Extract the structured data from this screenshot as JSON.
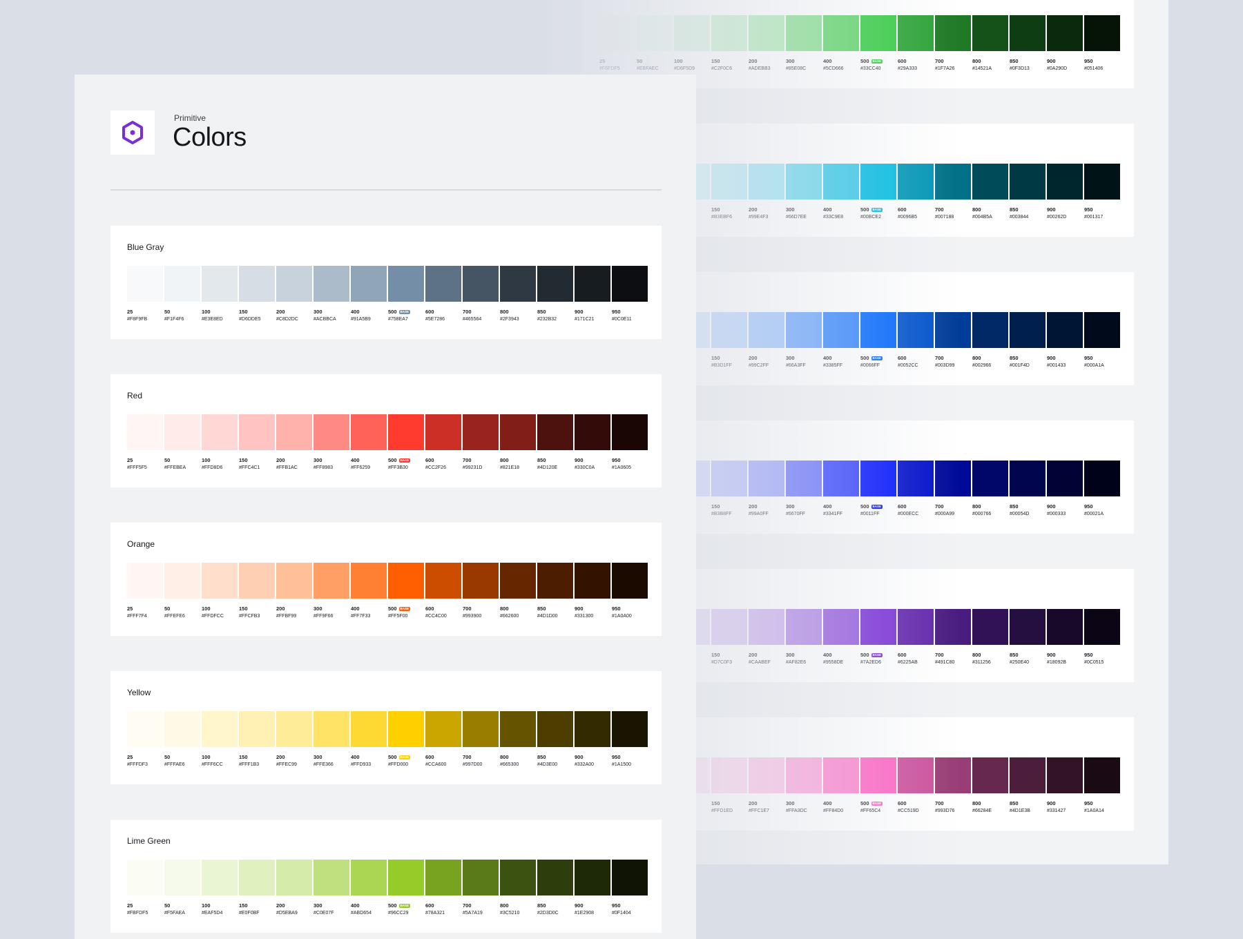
{
  "header": {
    "eyebrow": "Primitive",
    "title": "Colors",
    "logo_icon": "hexagon-logo-icon",
    "logo_color": "#7A2ED6"
  },
  "base_label": "BASE",
  "front_palettes": [
    {
      "name": "Blue Gray",
      "badge_color": "#758EA7",
      "swatches": [
        {
          "step": "25",
          "hex": "#F8F9FB",
          "color": "#F8F9FB"
        },
        {
          "step": "50",
          "hex": "#F1F4F6",
          "color": "#F1F4F6"
        },
        {
          "step": "100",
          "hex": "#E3E8ED",
          "color": "#E3E8ED"
        },
        {
          "step": "150",
          "hex": "#D6DDE5",
          "color": "#D6DDE5"
        },
        {
          "step": "200",
          "hex": "#C8D2DC",
          "color": "#C8D2DC"
        },
        {
          "step": "300",
          "hex": "#ACBBCA",
          "color": "#ACBBCA"
        },
        {
          "step": "400",
          "hex": "#91A5B9",
          "color": "#91A5B9"
        },
        {
          "step": "500",
          "hex": "#758EA7",
          "color": "#758EA7",
          "base": true
        },
        {
          "step": "600",
          "hex": "#5E7286",
          "color": "#5E7286"
        },
        {
          "step": "700",
          "hex": "#465564",
          "color": "#465564"
        },
        {
          "step": "800",
          "hex": "#2F3943",
          "color": "#2F3943"
        },
        {
          "step": "850",
          "hex": "#232B32",
          "color": "#232B32"
        },
        {
          "step": "900",
          "hex": "#171C21",
          "color": "#171C21"
        },
        {
          "step": "950",
          "hex": "#0C0E11",
          "color": "#0C0E11"
        }
      ]
    },
    {
      "name": "Red",
      "badge_color": "#FF3B30",
      "swatches": [
        {
          "step": "25",
          "hex": "#FFF5F5",
          "color": "#FFF5F5"
        },
        {
          "step": "50",
          "hex": "#FFEBEA",
          "color": "#FFEBEA"
        },
        {
          "step": "100",
          "hex": "#FFD8D6",
          "color": "#FFD8D6"
        },
        {
          "step": "150",
          "hex": "#FFC4C1",
          "color": "#FFC4C1"
        },
        {
          "step": "200",
          "hex": "#FFB1AC",
          "color": "#FFB1AC"
        },
        {
          "step": "300",
          "hex": "#FF8983",
          "color": "#FF8983"
        },
        {
          "step": "400",
          "hex": "#FF6259",
          "color": "#FF6259"
        },
        {
          "step": "500",
          "hex": "#FF3B30",
          "color": "#FF3B30",
          "base": true
        },
        {
          "step": "600",
          "hex": "#CC2F26",
          "color": "#CC2F26"
        },
        {
          "step": "700",
          "hex": "#99231D",
          "color": "#99231D"
        },
        {
          "step": "800",
          "hex": "#821E18",
          "color": "#821E18"
        },
        {
          "step": "850",
          "hex": "#4D120E",
          "color": "#4D120E"
        },
        {
          "step": "900",
          "hex": "#330C0A",
          "color": "#330C0A"
        },
        {
          "step": "950",
          "hex": "#1A0605",
          "color": "#1A0605"
        }
      ]
    },
    {
      "name": "Orange",
      "badge_color": "#FF5F00",
      "swatches": [
        {
          "step": "25",
          "hex": "#FFF7F4",
          "color": "#FFF7F4"
        },
        {
          "step": "50",
          "hex": "#FFEFE6",
          "color": "#FFEFE6"
        },
        {
          "step": "100",
          "hex": "#FFDFCC",
          "color": "#FFDFCC"
        },
        {
          "step": "150",
          "hex": "#FFCFB3",
          "color": "#FFCFB3"
        },
        {
          "step": "200",
          "hex": "#FFBF99",
          "color": "#FFBF99"
        },
        {
          "step": "300",
          "hex": "#FF9F66",
          "color": "#FF9F66"
        },
        {
          "step": "400",
          "hex": "#FF7F33",
          "color": "#FF7F33"
        },
        {
          "step": "500",
          "hex": "#FF5F00",
          "color": "#FF5F00",
          "base": true
        },
        {
          "step": "600",
          "hex": "#CC4C00",
          "color": "#CC4C00"
        },
        {
          "step": "700",
          "hex": "#993900",
          "color": "#993900"
        },
        {
          "step": "800",
          "hex": "#662600",
          "color": "#662600"
        },
        {
          "step": "850",
          "hex": "#4D1D00",
          "color": "#4D1D00"
        },
        {
          "step": "900",
          "hex": "#331300",
          "color": "#331300"
        },
        {
          "step": "950",
          "hex": "#1A0A00",
          "color": "#1A0A00"
        }
      ]
    },
    {
      "name": "Yellow",
      "badge_color": "#FFD000",
      "swatches": [
        {
          "step": "25",
          "hex": "#FFFDF3",
          "color": "#FFFDF3"
        },
        {
          "step": "50",
          "hex": "#FFFAE6",
          "color": "#FFFAE6"
        },
        {
          "step": "100",
          "hex": "#FFF6CC",
          "color": "#FFF6CC"
        },
        {
          "step": "150",
          "hex": "#FFF1B3",
          "color": "#FFF1B3"
        },
        {
          "step": "200",
          "hex": "#FFEC99",
          "color": "#FFEC99"
        },
        {
          "step": "300",
          "hex": "#FFE366",
          "color": "#FFE366"
        },
        {
          "step": "400",
          "hex": "#FFD933",
          "color": "#FFD933"
        },
        {
          "step": "500",
          "hex": "#FFD000",
          "color": "#FFD000",
          "base": true
        },
        {
          "step": "600",
          "hex": "#CCA600",
          "color": "#CCA600"
        },
        {
          "step": "700",
          "hex": "#997D00",
          "color": "#997D00"
        },
        {
          "step": "800",
          "hex": "#665300",
          "color": "#665300"
        },
        {
          "step": "850",
          "hex": "#4D3E00",
          "color": "#4D3E00"
        },
        {
          "step": "900",
          "hex": "#332A00",
          "color": "#332A00"
        },
        {
          "step": "950",
          "hex": "#1A1500",
          "color": "#1A1500"
        }
      ]
    },
    {
      "name": "Lime Green",
      "badge_color": "#96CC29",
      "swatches": [
        {
          "step": "25",
          "hex": "#FBFDF5",
          "color": "#FBFDF5"
        },
        {
          "step": "50",
          "hex": "#F5FAEA",
          "color": "#F5FAEA"
        },
        {
          "step": "100",
          "hex": "#EAF5D4",
          "color": "#EAF5D4"
        },
        {
          "step": "150",
          "hex": "#E0F0BF",
          "color": "#E0F0BF"
        },
        {
          "step": "200",
          "hex": "#D5EBA9",
          "color": "#D5EBA9"
        },
        {
          "step": "300",
          "hex": "#C0E07F",
          "color": "#C0E07F"
        },
        {
          "step": "400",
          "hex": "#ABD654",
          "color": "#ABD654"
        },
        {
          "step": "500",
          "hex": "#96CC29",
          "color": "#96CC29",
          "base": true
        },
        {
          "step": "600",
          "hex": "#78A321",
          "color": "#78A321"
        },
        {
          "step": "700",
          "hex": "#5A7A19",
          "color": "#5A7A19"
        },
        {
          "step": "800",
          "hex": "#3C5210",
          "color": "#3C5210"
        },
        {
          "step": "850",
          "hex": "#2D3D0C",
          "color": "#2D3D0C"
        },
        {
          "step": "900",
          "hex": "#1E2908",
          "color": "#1E2908"
        },
        {
          "step": "950",
          "hex": "#0F1404",
          "color": "#0F1404"
        }
      ]
    }
  ],
  "back_palettes": [
    {
      "badge_color": "#33CC40",
      "swatches": [
        {
          "step": "25",
          "hex": "#F6FDF5",
          "color": "#F6FDF5"
        },
        {
          "step": "50",
          "hex": "#EBFAEC",
          "color": "#EBFAEC"
        },
        {
          "step": "100",
          "hex": "#D6F5D9",
          "color": "#D6F5D9"
        },
        {
          "step": "150",
          "hex": "#C2F0C6",
          "color": "#C2F0C6"
        },
        {
          "step": "200",
          "hex": "#ADEBB3",
          "color": "#ADEBB3"
        },
        {
          "step": "300",
          "hex": "#85E08C",
          "color": "#85E08C"
        },
        {
          "step": "400",
          "hex": "#5CD666",
          "color": "#5CD666"
        },
        {
          "step": "500",
          "hex": "#33CC40",
          "color": "#33CC40",
          "base": true
        },
        {
          "step": "600",
          "hex": "#29A333",
          "color": "#29A333"
        },
        {
          "step": "700",
          "hex": "#1F7A26",
          "color": "#1F7A26"
        },
        {
          "step": "800",
          "hex": "#14521A",
          "color": "#14521A"
        },
        {
          "step": "850",
          "hex": "#0F3D13",
          "color": "#0F3D13"
        },
        {
          "step": "900",
          "hex": "#0A290D",
          "color": "#0A290D"
        },
        {
          "step": "950",
          "hex": "#051406",
          "color": "#051406"
        }
      ]
    },
    {
      "badge_color": "#00BCE2",
      "swatches": [
        {
          "step": "",
          "hex": "",
          "color": "#CCF2F9"
        },
        {
          "step": "",
          "hex": "",
          "color": "#CCF2F9"
        },
        {
          "step": "",
          "hex": "",
          "color": "#CCF2F9"
        },
        {
          "step": "150",
          "hex": "#B3EBF6",
          "color": "#B3EBF6"
        },
        {
          "step": "200",
          "hex": "#99E4F3",
          "color": "#99E4F3"
        },
        {
          "step": "300",
          "hex": "#66D7EE",
          "color": "#66D7EE"
        },
        {
          "step": "400",
          "hex": "#33C9E8",
          "color": "#33C9E8"
        },
        {
          "step": "500",
          "hex": "#00BCE2",
          "color": "#00BCE2",
          "base": true
        },
        {
          "step": "600",
          "hex": "#0096B5",
          "color": "#0096B5"
        },
        {
          "step": "700",
          "hex": "#007188",
          "color": "#007188"
        },
        {
          "step": "800",
          "hex": "#004B5A",
          "color": "#004B5A"
        },
        {
          "step": "850",
          "hex": "#003844",
          "color": "#003844"
        },
        {
          "step": "900",
          "hex": "#00262D",
          "color": "#00262D"
        },
        {
          "step": "950",
          "hex": "#001317",
          "color": "#001317"
        }
      ]
    },
    {
      "badge_color": "#0066FF",
      "swatches": [
        {
          "step": "",
          "hex": "",
          "color": "#CCE0FF"
        },
        {
          "step": "",
          "hex": "",
          "color": "#CCE0FF"
        },
        {
          "step": "",
          "hex": "",
          "color": "#CCE0FF"
        },
        {
          "step": "150",
          "hex": "#B3D1FF",
          "color": "#B3D1FF"
        },
        {
          "step": "200",
          "hex": "#99C2FF",
          "color": "#99C2FF"
        },
        {
          "step": "300",
          "hex": "#66A3FF",
          "color": "#66A3FF"
        },
        {
          "step": "400",
          "hex": "#3385FF",
          "color": "#3385FF"
        },
        {
          "step": "500",
          "hex": "#0066FF",
          "color": "#0066FF",
          "base": true
        },
        {
          "step": "600",
          "hex": "#0052CC",
          "color": "#0052CC"
        },
        {
          "step": "700",
          "hex": "#003D99",
          "color": "#003D99"
        },
        {
          "step": "800",
          "hex": "#002966",
          "color": "#002966"
        },
        {
          "step": "850",
          "hex": "#001F4D",
          "color": "#001F4D"
        },
        {
          "step": "900",
          "hex": "#001433",
          "color": "#001433"
        },
        {
          "step": "950",
          "hex": "#000A1A",
          "color": "#000A1A"
        }
      ]
    },
    {
      "badge_color": "#0011FF",
      "swatches": [
        {
          "step": "",
          "hex": "",
          "color": "#CCCFFF"
        },
        {
          "step": "",
          "hex": "",
          "color": "#CCCFFF"
        },
        {
          "step": "",
          "hex": "",
          "color": "#CCCFFF"
        },
        {
          "step": "150",
          "hex": "#B3B8FF",
          "color": "#B3B8FF"
        },
        {
          "step": "200",
          "hex": "#99A0FF",
          "color": "#99A0FF"
        },
        {
          "step": "300",
          "hex": "#6670FF",
          "color": "#6670FF"
        },
        {
          "step": "400",
          "hex": "#3341FF",
          "color": "#3341FF"
        },
        {
          "step": "500",
          "hex": "#0011FF",
          "color": "#0011FF",
          "base": true
        },
        {
          "step": "600",
          "hex": "#000ECC",
          "color": "#000ECC"
        },
        {
          "step": "700",
          "hex": "#000A99",
          "color": "#000A99"
        },
        {
          "step": "800",
          "hex": "#000766",
          "color": "#000766"
        },
        {
          "step": "850",
          "hex": "#00054D",
          "color": "#00054D"
        },
        {
          "step": "900",
          "hex": "#000333",
          "color": "#000333"
        },
        {
          "step": "950",
          "hex": "#00021A",
          "color": "#00021A"
        }
      ]
    },
    {
      "badge_color": "#7A2ED6",
      "swatches": [
        {
          "step": "",
          "hex": "",
          "color": "#E4D5F7"
        },
        {
          "step": "",
          "hex": "",
          "color": "#E4D5F7"
        },
        {
          "step": "",
          "hex": "",
          "color": "#E4D5F7"
        },
        {
          "step": "150",
          "hex": "#D7C0F3",
          "color": "#D7C0F3"
        },
        {
          "step": "200",
          "hex": "#CAABEF",
          "color": "#CAABEF"
        },
        {
          "step": "300",
          "hex": "#AF82E6",
          "color": "#AF82E6"
        },
        {
          "step": "400",
          "hex": "#9558DE",
          "color": "#9558DE"
        },
        {
          "step": "500",
          "hex": "#7A2ED6",
          "color": "#7A2ED6",
          "base": true
        },
        {
          "step": "600",
          "hex": "#6225AB",
          "color": "#6225AB"
        },
        {
          "step": "700",
          "hex": "#491C80",
          "color": "#491C80"
        },
        {
          "step": "800",
          "hex": "#311256",
          "color": "#311256"
        },
        {
          "step": "850",
          "hex": "#250E40",
          "color": "#250E40"
        },
        {
          "step": "900",
          "hex": "#18092B",
          "color": "#18092B"
        },
        {
          "step": "950",
          "hex": "#0C0515",
          "color": "#0C0515"
        }
      ]
    },
    {
      "badge_color": "#FF65C4",
      "swatches": [
        {
          "step": "",
          "hex": "",
          "color": "#FFE0F3"
        },
        {
          "step": "",
          "hex": "",
          "color": "#FFE0F3"
        },
        {
          "step": "",
          "hex": "",
          "color": "#FFE0F3"
        },
        {
          "step": "150",
          "hex": "#FFD1ED",
          "color": "#FFD1ED"
        },
        {
          "step": "200",
          "hex": "#FFC1E7",
          "color": "#FFC1E7"
        },
        {
          "step": "300",
          "hex": "#FFA3DC",
          "color": "#FFA3DC"
        },
        {
          "step": "400",
          "hex": "#FF84D0",
          "color": "#FF84D0"
        },
        {
          "step": "500",
          "hex": "#FF65C4",
          "color": "#FF65C4",
          "base": true
        },
        {
          "step": "600",
          "hex": "#CC519D",
          "color": "#CC519D"
        },
        {
          "step": "700",
          "hex": "#993D76",
          "color": "#993D76"
        },
        {
          "step": "800",
          "hex": "#66284E",
          "color": "#66284E"
        },
        {
          "step": "850",
          "hex": "#4D1E3B",
          "color": "#4D1E3B"
        },
        {
          "step": "900",
          "hex": "#331427",
          "color": "#331427"
        },
        {
          "step": "950",
          "hex": "#1A0A14",
          "color": "#1A0A14"
        }
      ]
    }
  ]
}
